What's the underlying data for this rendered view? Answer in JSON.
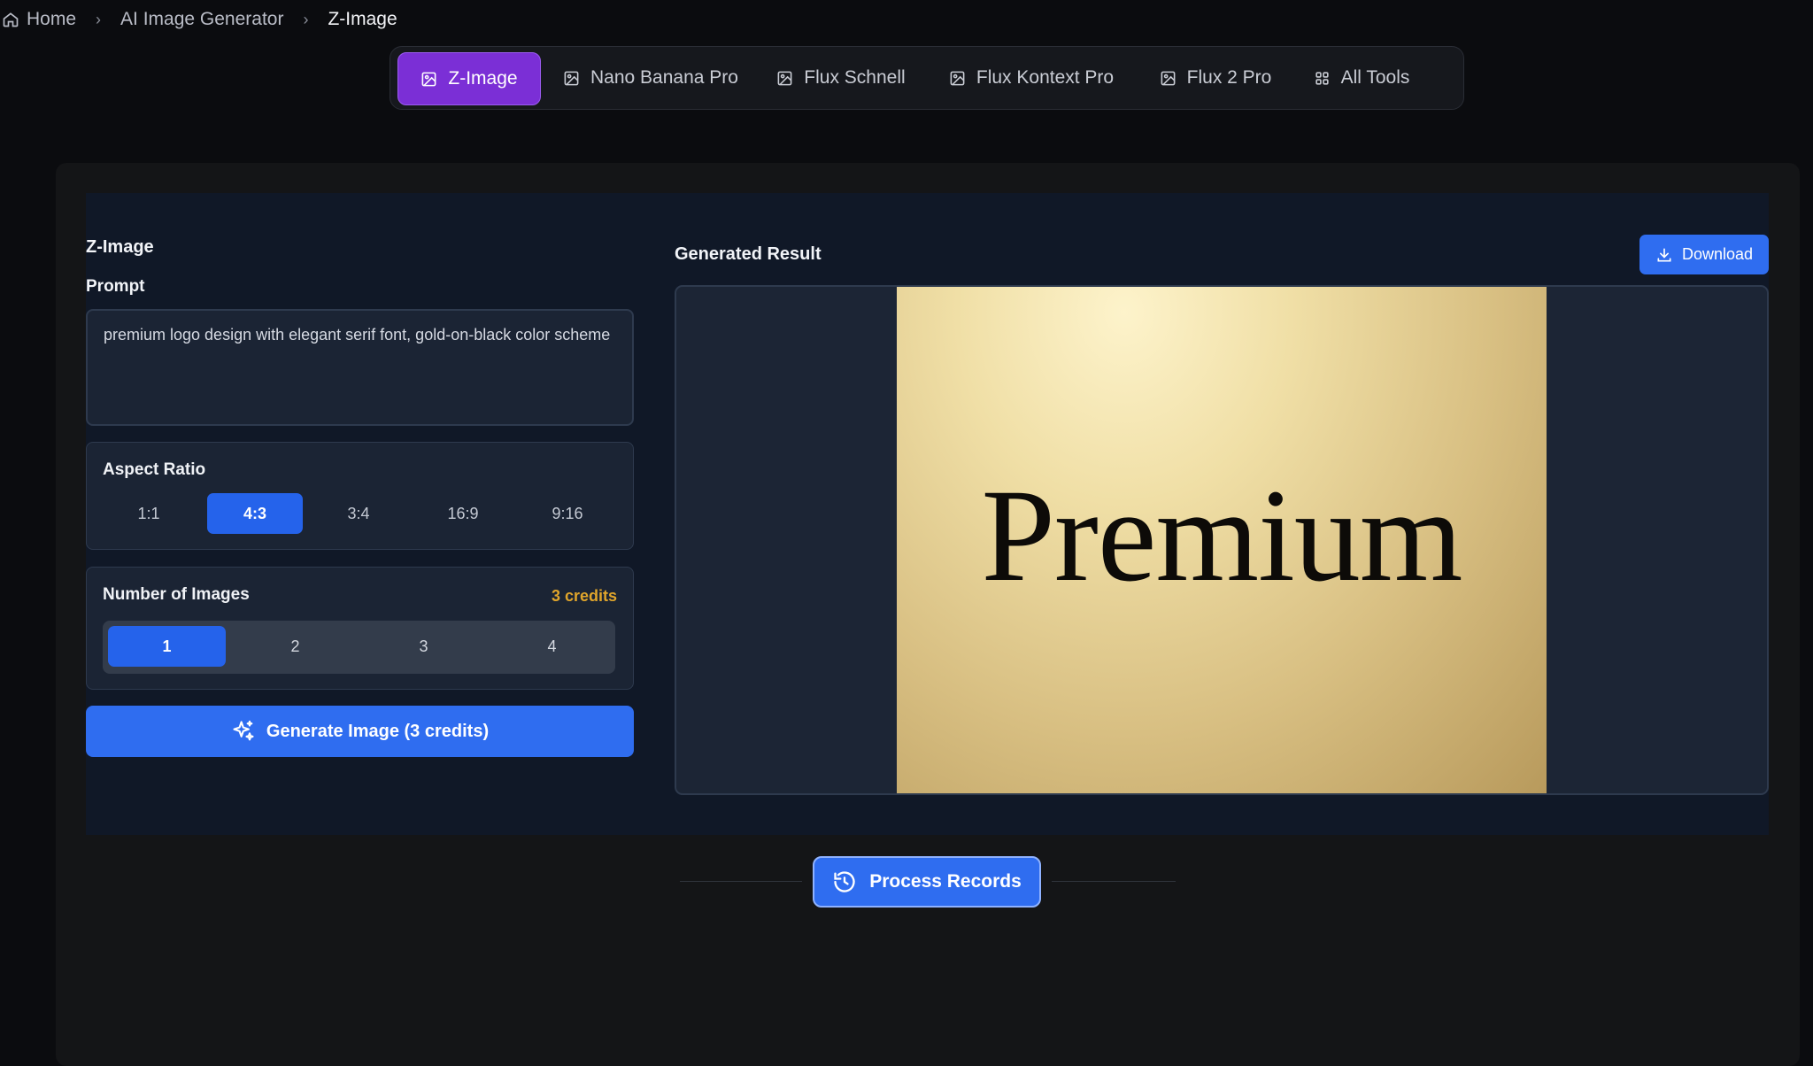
{
  "breadcrumb": {
    "items": [
      "Home",
      "AI Image Generator",
      "Z-Image"
    ],
    "separator": "›"
  },
  "tabs": [
    {
      "label": "Z-Image",
      "icon": "image-icon",
      "active": true
    },
    {
      "label": "Nano Banana Pro",
      "icon": "image-icon",
      "active": false
    },
    {
      "label": "Flux Schnell",
      "icon": "image-icon",
      "active": false
    },
    {
      "label": "Flux Kontext Pro",
      "icon": "image-icon",
      "active": false
    },
    {
      "label": "Flux 2 Pro",
      "icon": "image-icon",
      "active": false
    },
    {
      "label": "All Tools",
      "icon": "grid-icon",
      "active": false
    }
  ],
  "form": {
    "title": "Z-Image",
    "prompt_label": "Prompt",
    "prompt_value": "premium logo design with elegant serif font, gold-on-black color scheme",
    "aspect_ratio": {
      "label": "Aspect Ratio",
      "options": [
        "1:1",
        "4:3",
        "3:4",
        "16:9",
        "9:16"
      ],
      "selected": "4:3"
    },
    "num_images": {
      "label": "Number of Images",
      "credits": "3 credits",
      "options": [
        "1",
        "2",
        "3",
        "4"
      ],
      "selected": "1"
    },
    "generate_button": "Generate Image (3 credits)"
  },
  "result": {
    "title": "Generated Result",
    "download_label": "Download",
    "image_text": "Premium"
  },
  "records_button": "Process Records",
  "colors": {
    "accent_purple": "#7b2fd6",
    "primary_blue": "#2f6df0",
    "credits_gold": "#e0a52b"
  }
}
